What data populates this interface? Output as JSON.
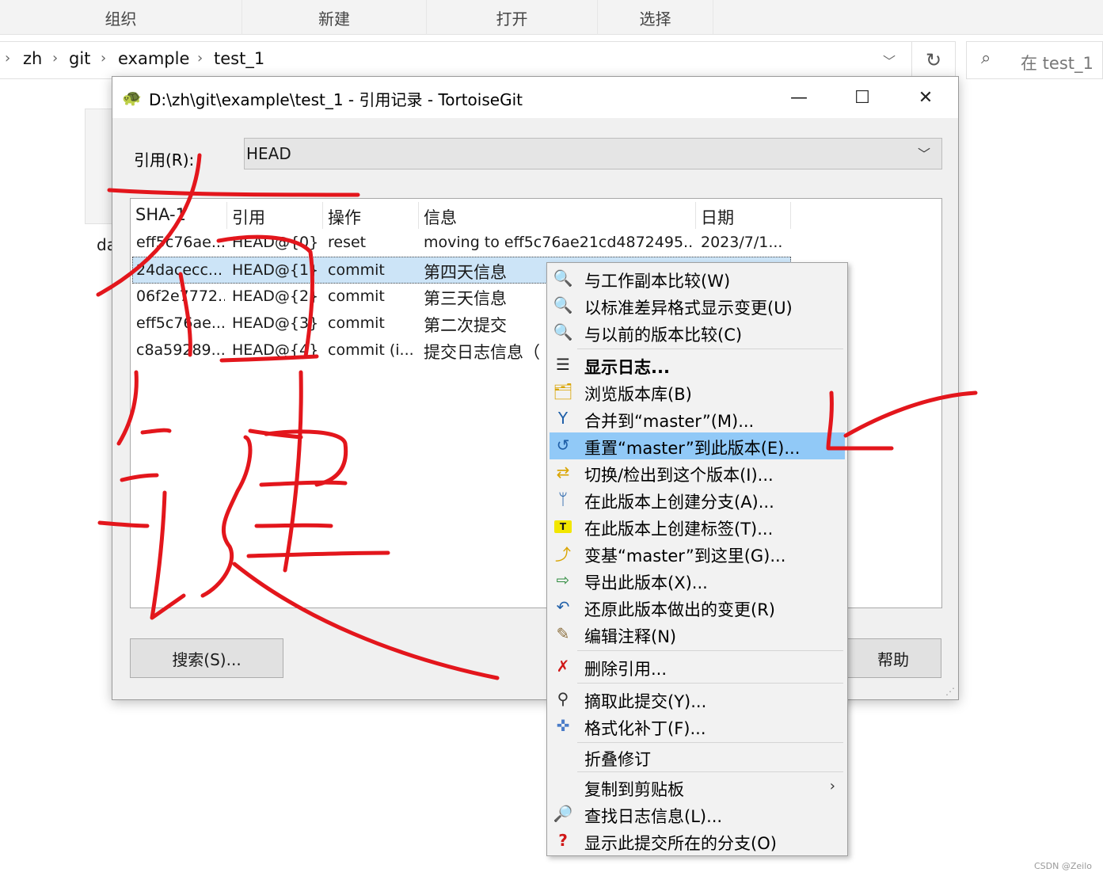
{
  "explorer": {
    "ribbon_tabs": [
      "组织",
      "新建",
      "打开",
      "选择"
    ],
    "breadcrumb": [
      "zh",
      "git",
      "example",
      "test_1"
    ],
    "search_placeholder": "在 test_1",
    "behind_file_label": "da"
  },
  "dialog": {
    "title": "D:\\zh\\git\\example\\test_1 - 引用记录 - TortoiseGit",
    "ref_label": "引用(R):",
    "ref_value": "HEAD",
    "columns": [
      "SHA-1",
      "引用",
      "操作",
      "信息",
      "日期"
    ],
    "rows": [
      {
        "sha": "eff5c76ae...",
        "ref": "HEAD@{0}",
        "action": "reset",
        "message": "moving to eff5c76ae21cd4872495...",
        "date": "2023/7/1..."
      },
      {
        "sha": "24dacecc...",
        "ref": "HEAD@{1}",
        "action": "commit",
        "message": "第四天信息",
        "date": ""
      },
      {
        "sha": "06f2e7772...",
        "ref": "HEAD@{2}",
        "action": "commit",
        "message": "第三天信息",
        "date": ""
      },
      {
        "sha": "eff5c76ae...",
        "ref": "HEAD@{3}",
        "action": "commit",
        "message": "第二次提交",
        "date": ""
      },
      {
        "sha": "c8a59289...",
        "ref": "HEAD@{4}",
        "action": "commit (i...",
        "message": "提交日志信息（",
        "date": ""
      }
    ],
    "search_button": "搜索(S)...",
    "help_button": "帮助",
    "window_controls": {
      "minimize": "—",
      "maximize": "☐",
      "close": "✕"
    }
  },
  "context_menu": {
    "items": [
      {
        "label": "与工作副本比较(W)",
        "icon": "magnifier-diff-icon"
      },
      {
        "label": "以标准差异格式显示变更(U)",
        "icon": "magnifier-unified-diff-icon"
      },
      {
        "label": "与以前的版本比较(C)",
        "icon": "magnifier-compare-icon"
      },
      {
        "label": "显示日志...",
        "icon": "show-log-icon",
        "bold": true
      },
      {
        "label": "浏览版本库(B)",
        "icon": "repo-browser-icon"
      },
      {
        "label": "合并到“master”(M)...",
        "icon": "merge-icon"
      },
      {
        "label": "重置“master”到此版本(E)...",
        "icon": "reset-icon",
        "highlighted": true
      },
      {
        "label": "切换/检出到这个版本(I)...",
        "icon": "switch-checkout-icon"
      },
      {
        "label": "在此版本上创建分支(A)...",
        "icon": "create-branch-icon"
      },
      {
        "label": "在此版本上创建标签(T)...",
        "icon": "create-tag-icon"
      },
      {
        "label": "变基“master”到这里(G)...",
        "icon": "rebase-icon"
      },
      {
        "label": "导出此版本(X)...",
        "icon": "export-icon"
      },
      {
        "label": "还原此版本做出的变更(R)",
        "icon": "revert-icon"
      },
      {
        "label": "编辑注释(N)",
        "icon": "edit-notes-icon"
      },
      {
        "label": "删除引用...",
        "icon": "delete-ref-icon"
      },
      {
        "label": "摘取此提交(Y)...",
        "icon": "cherry-pick-icon"
      },
      {
        "label": "格式化补丁(F)...",
        "icon": "format-patch-icon"
      },
      {
        "label": "折叠修订",
        "icon": ""
      },
      {
        "label": "复制到剪贴板",
        "icon": "",
        "submenu": true
      },
      {
        "label": "查找日志信息(L)...",
        "icon": "find-log-icon"
      },
      {
        "label": "显示此提交所在的分支(O)",
        "icon": "show-branches-icon"
      }
    ]
  },
  "annotation": {
    "ink_color": "#e3161c",
    "handwritten_text": "右键",
    "arrow_points_to": "重置“master”到此版本(E)..."
  },
  "watermark": "CSDN @Zeilo",
  "colors": {
    "highlight": "#91c9f7",
    "selected_row": "#cce4f7",
    "dialog_bg": "#f0f0f0"
  }
}
